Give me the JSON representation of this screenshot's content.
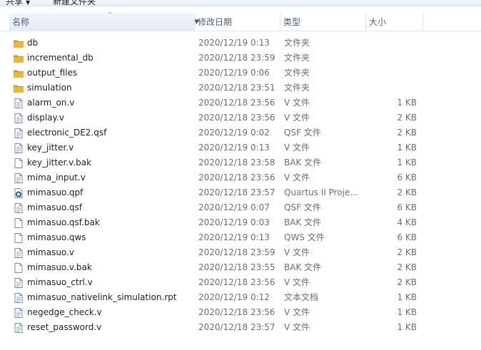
{
  "toolbar": {
    "share_label": "共享",
    "share_arrow": "▼",
    "new_folder_label": "新建文件夹"
  },
  "columns": {
    "name": "名称",
    "date": "修改日期",
    "type": "类型",
    "size": "大小",
    "sort_arrow": "^",
    "dropdown_arrow": "▼"
  },
  "files": [
    {
      "name": "db",
      "date": "2020/12/19 0:13",
      "type": "文件夹",
      "size": "",
      "icon": "folder-icon"
    },
    {
      "name": "incremental_db",
      "date": "2020/12/18 23:59",
      "type": "文件夹",
      "size": "",
      "icon": "folder-icon"
    },
    {
      "name": "output_files",
      "date": "2020/12/19 0:06",
      "type": "文件夹",
      "size": "",
      "icon": "folder-icon"
    },
    {
      "name": "simulation",
      "date": "2020/12/18 23:51",
      "type": "文件夹",
      "size": "",
      "icon": "folder-icon"
    },
    {
      "name": "alarm_on.v",
      "date": "2020/12/18 23:56",
      "type": "V 文件",
      "size": "1 KB",
      "icon": "text-file-icon"
    },
    {
      "name": "display.v",
      "date": "2020/12/18 23:56",
      "type": "V 文件",
      "size": "2 KB",
      "icon": "text-file-icon"
    },
    {
      "name": "electronic_DE2.qsf",
      "date": "2020/12/19 0:02",
      "type": "QSF 文件",
      "size": "2 KB",
      "icon": "text-file-icon"
    },
    {
      "name": "key_jitter.v",
      "date": "2020/12/19 0:13",
      "type": "V 文件",
      "size": "1 KB",
      "icon": "text-file-icon"
    },
    {
      "name": "key_jitter.v.bak",
      "date": "2020/12/18 23:58",
      "type": "BAK 文件",
      "size": "1 KB",
      "icon": "blank-file-icon"
    },
    {
      "name": "mima_input.v",
      "date": "2020/12/18 23:56",
      "type": "V 文件",
      "size": "6 KB",
      "icon": "text-file-icon"
    },
    {
      "name": "mimasuo.qpf",
      "date": "2020/12/18 23:57",
      "type": "Quartus II Proje...",
      "size": "2 KB",
      "icon": "quartus-project-icon"
    },
    {
      "name": "mimasuo.qsf",
      "date": "2020/12/19 0:07",
      "type": "QSF 文件",
      "size": "6 KB",
      "icon": "text-file-icon"
    },
    {
      "name": "mimasuo.qsf.bak",
      "date": "2020/12/19 0:03",
      "type": "BAK 文件",
      "size": "4 KB",
      "icon": "blank-file-icon"
    },
    {
      "name": "mimasuo.qws",
      "date": "2020/12/19 0:13",
      "type": "QWS 文件",
      "size": "6 KB",
      "icon": "blank-file-icon"
    },
    {
      "name": "mimasuo.v",
      "date": "2020/12/18 23:59",
      "type": "V 文件",
      "size": "2 KB",
      "icon": "text-file-icon"
    },
    {
      "name": "mimasuo.v.bak",
      "date": "2020/12/18 23:55",
      "type": "BAK 文件",
      "size": "2 KB",
      "icon": "blank-file-icon"
    },
    {
      "name": "mimasuo_ctrl.v",
      "date": "2020/12/18 23:56",
      "type": "V 文件",
      "size": "2 KB",
      "icon": "text-file-icon"
    },
    {
      "name": "mimasuo_nativelink_simulation.rpt",
      "date": "2020/12/19 0:12",
      "type": "文本文档",
      "size": "1 KB",
      "icon": "text-file-icon"
    },
    {
      "name": "negedge_check.v",
      "date": "2020/12/18 23:56",
      "type": "V 文件",
      "size": "1 KB",
      "icon": "text-file-icon"
    },
    {
      "name": "reset_password.v",
      "date": "2020/12/18 23:57",
      "type": "V 文件",
      "size": "1 KB",
      "icon": "text-file-icon"
    }
  ],
  "colors": {
    "folder": "#e8b93c",
    "folder_dark": "#c9961f",
    "header_text": "#4c607a",
    "detail_text": "#6d6d6d",
    "quartus_blue": "#2b4fa8"
  }
}
